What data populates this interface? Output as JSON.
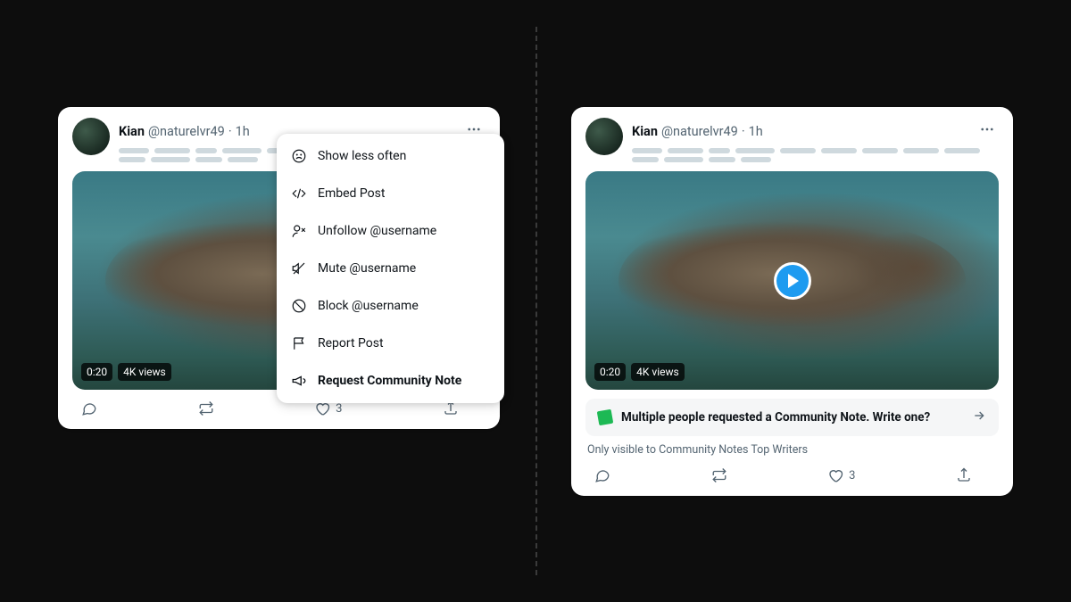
{
  "post": {
    "name": "Kian",
    "handle": "@naturelvr49",
    "separator": "·",
    "time": "1h",
    "video_duration": "0:20",
    "views": "4K views",
    "like_count": "3"
  },
  "menu": {
    "show_less": "Show less often",
    "embed": "Embed Post",
    "unfollow": "Unfollow @username",
    "mute": "Mute @username",
    "block": "Block @username",
    "report": "Report Post",
    "request_cn": "Request Community Note"
  },
  "cn": {
    "prompt": "Multiple people requested a Community Note. Write one?",
    "visibility": "Only visible to Community Notes Top Writers"
  }
}
